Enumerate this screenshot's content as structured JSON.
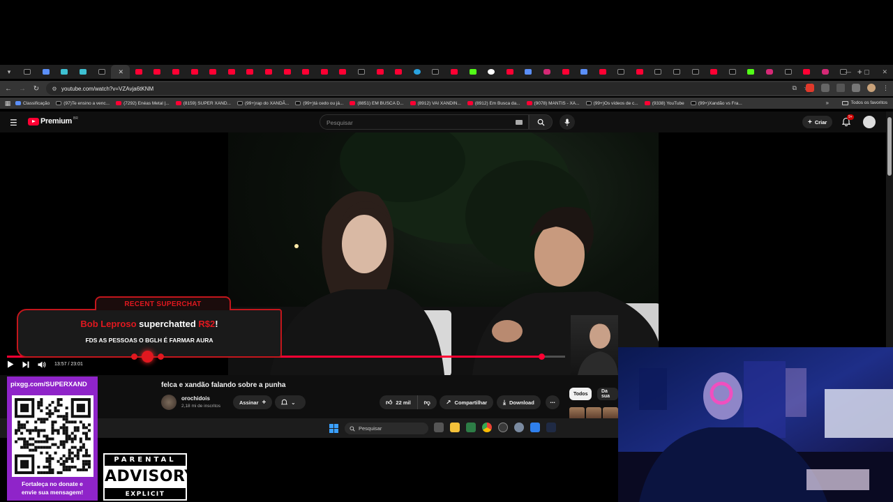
{
  "browser": {
    "url": "youtube.com/watch?v=VZAvja6tKNM",
    "tabs": [
      "tt",
      "bl",
      "cy",
      "cy",
      "tt",
      "x",
      "yt",
      "yt",
      "yt",
      "yt",
      "yt",
      "yt",
      "yt",
      "yt",
      "yt",
      "yt",
      "yt",
      "yt",
      "tt",
      "yt",
      "yt",
      "tg",
      "tt",
      "yt",
      "kk",
      "gg",
      "yt",
      "bl",
      "ig",
      "yt",
      "bl",
      "yt",
      "tt",
      "yt",
      "tt",
      "tt",
      "tt",
      "yt",
      "tt",
      "kk",
      "ig",
      "tt",
      "yt",
      "ig",
      "tt"
    ],
    "bookmarks": [
      {
        "icon": "bl",
        "label": "Classificação"
      },
      {
        "icon": "tt",
        "label": "(97)Te ensino a venc..."
      },
      {
        "icon": "yt",
        "label": "(7292) Enéas Metal |..."
      },
      {
        "icon": "yt",
        "label": "(8159) SUPER XAND..."
      },
      {
        "icon": "tt",
        "label": "(99+)rap do XANDÃ..."
      },
      {
        "icon": "tt",
        "label": "(99+)tá cedo ou já..."
      },
      {
        "icon": "yt",
        "label": "(8851) EM BUSCA D..."
      },
      {
        "icon": "yt",
        "label": "(8912) VAI XANDIN..."
      },
      {
        "icon": "yt",
        "label": "(8912) Em Busca da..."
      },
      {
        "icon": "yt",
        "label": "(9078) MANTIS - XA..."
      },
      {
        "icon": "tt",
        "label": "(99+)Os vídeos de c..."
      },
      {
        "icon": "yt",
        "label": "(9338) YouTube"
      },
      {
        "icon": "tt",
        "label": "(99+)Xandão vs Fra..."
      }
    ],
    "all_bookmarks_label": "Todos os favoritos"
  },
  "youtube": {
    "logo_text": "Premium",
    "region": "BR",
    "search_placeholder": "Pesquisar",
    "create_label": "Criar",
    "notifications_badge": "9+"
  },
  "player": {
    "current_time": "13:57",
    "duration": "23:01",
    "time_display": "13:57 / 23:01",
    "progress_fraction": 0.958,
    "buffered_fraction": 1.0
  },
  "video": {
    "title": "felca e xandão falando sobre a punha",
    "channel": "orochidois",
    "subscribers": "2,18 mi de inscritos",
    "subscribe_label": "Assinar",
    "likes": "22 mil",
    "share_label": "Compartilhar",
    "download_label": "Download",
    "chips": [
      "Todos",
      "Da sua"
    ]
  },
  "superchat": {
    "header": "RECENT SUPERCHAT",
    "user": "Bob Leproso",
    "action": "superchatted",
    "amount": "R$2",
    "exclaim": "!",
    "message": "FDS AS PESSOAS O BGLH É FARMAR AURA"
  },
  "donation": {
    "url": "pixgg.com/SUPERXAND",
    "message_line1": "Fortaleça no donate e",
    "message_line2": "envie sua mensagem!"
  },
  "advisory": {
    "top": "PARENTAL",
    "middle": "ADVISORY",
    "bottom": "EXPLICIT CONTENT"
  },
  "taskbar": {
    "search_label": "Pesquisar"
  },
  "colors": {
    "youtube_red": "#ff0033",
    "overlay_red": "#e0181f",
    "donate_purple": "#8f24c9"
  }
}
